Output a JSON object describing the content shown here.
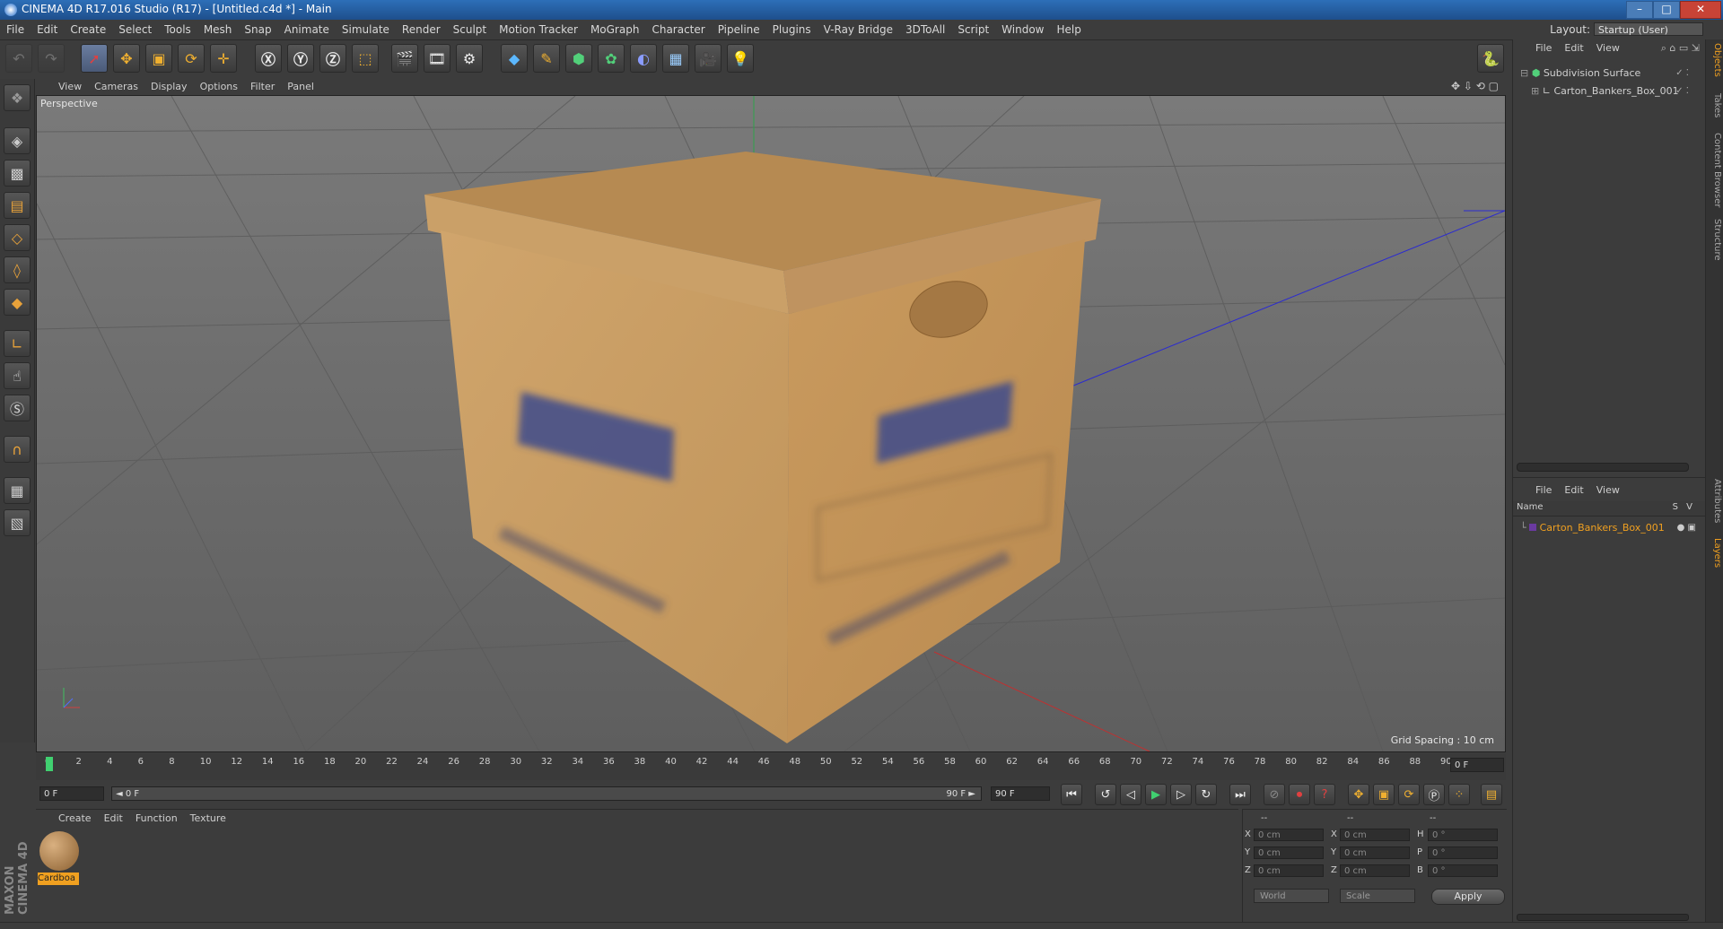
{
  "window": {
    "title": "CINEMA 4D R17.016 Studio (R17) - [Untitled.c4d *] - Main",
    "controls": [
      "–",
      "□",
      "✕"
    ]
  },
  "menu": [
    "File",
    "Edit",
    "Create",
    "Select",
    "Tools",
    "Mesh",
    "Snap",
    "Animate",
    "Simulate",
    "Render",
    "Sculpt",
    "Motion Tracker",
    "MoGraph",
    "Character",
    "Pipeline",
    "Plugins",
    "V-Ray Bridge",
    "3DToAll",
    "Script",
    "Window",
    "Help"
  ],
  "layout": {
    "label": "Layout:",
    "value": "Startup (User)"
  },
  "viewport": {
    "menu": [
      "View",
      "Cameras",
      "Display",
      "Options",
      "Filter",
      "Panel"
    ],
    "label": "Perspective",
    "grid_spacing": "Grid Spacing : 10 cm"
  },
  "object_manager": {
    "menu": [
      "File",
      "Edit",
      "View"
    ],
    "objects": [
      "Subdivision Surface",
      "Carton_Bankers_Box_001"
    ]
  },
  "layer_manager": {
    "menu": [
      "File",
      "Edit",
      "View"
    ],
    "columns": {
      "name": "Name",
      "s": "S",
      "v": "V"
    },
    "layers": [
      "Carton_Bankers_Box_001"
    ]
  },
  "side_tabs": [
    "Objects",
    "Takes",
    "Content Browser",
    "Structure",
    "Attributes",
    "Layers"
  ],
  "timeline": {
    "ticks": [
      "0",
      "2",
      "4",
      "6",
      "8",
      "10",
      "12",
      "14",
      "16",
      "18",
      "20",
      "22",
      "24",
      "26",
      "28",
      "30",
      "32",
      "34",
      "36",
      "38",
      "40",
      "42",
      "44",
      "46",
      "48",
      "50",
      "52",
      "54",
      "56",
      "58",
      "60",
      "62",
      "64",
      "66",
      "68",
      "70",
      "72",
      "74",
      "76",
      "78",
      "80",
      "82",
      "84",
      "86",
      "88",
      "90"
    ],
    "current_frame": "0 F"
  },
  "transport": {
    "start": "0 F",
    "range_start": "◄ 0 F",
    "range_end": "90 F ►",
    "end": "90 F"
  },
  "material_manager": {
    "menu": [
      "Create",
      "Edit",
      "Function",
      "Texture"
    ],
    "materials": [
      "Cardboa"
    ]
  },
  "coordinates": {
    "header": [
      "--",
      "--",
      "--"
    ],
    "rows": [
      {
        "a": "X",
        "av": "0 cm",
        "b": "X",
        "bv": "0 cm",
        "c": "H",
        "cv": "0 °"
      },
      {
        "a": "Y",
        "av": "0 cm",
        "b": "Y",
        "bv": "0 cm",
        "c": "P",
        "cv": "0 °"
      },
      {
        "a": "Z",
        "av": "0 cm",
        "b": "Z",
        "bv": "0 cm",
        "c": "B",
        "cv": "0 °"
      }
    ],
    "mode": "World",
    "transform": "Scale",
    "apply": "Apply"
  },
  "branding": "MAXON CINEMA 4D"
}
